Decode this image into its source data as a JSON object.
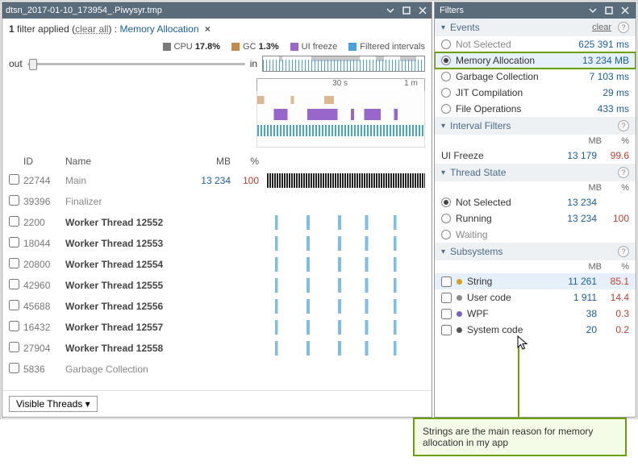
{
  "left": {
    "title": "dtsn_2017-01-10_173954_.Piwysyr.tmp",
    "filterbar": {
      "count": "1",
      "applied_text": "filter applied",
      "clear_all": "clear all",
      "active_filter": "Memory Allocation"
    },
    "legend": {
      "cpu_label": "CPU",
      "cpu_value": "17.8%",
      "gc_label": "GC",
      "gc_value": "1.3%",
      "ui_label": "UI freeze",
      "fi_label": "Filtered intervals",
      "out": "out",
      "in": "in"
    },
    "timeline": {
      "t1": "30 s",
      "t2": "1 m"
    },
    "columns": {
      "id": "ID",
      "name": "Name",
      "mb": "MB",
      "pct": "%"
    },
    "threads": [
      {
        "id": "22744",
        "name": "Main",
        "bold": false,
        "mb": "13 234",
        "pct": "100",
        "spark": "full"
      },
      {
        "id": "39396",
        "name": "Finalizer",
        "bold": false,
        "mb": "",
        "pct": "",
        "spark": "none"
      },
      {
        "id": "2200",
        "name": "Worker Thread 12552",
        "bold": true,
        "mb": "",
        "pct": "",
        "spark": "blue"
      },
      {
        "id": "18044",
        "name": "Worker Thread 12553",
        "bold": true,
        "mb": "",
        "pct": "",
        "spark": "blue"
      },
      {
        "id": "20800",
        "name": "Worker Thread 12554",
        "bold": true,
        "mb": "",
        "pct": "",
        "spark": "blue"
      },
      {
        "id": "42960",
        "name": "Worker Thread 12555",
        "bold": true,
        "mb": "",
        "pct": "",
        "spark": "blue"
      },
      {
        "id": "45688",
        "name": "Worker Thread 12556",
        "bold": true,
        "mb": "",
        "pct": "",
        "spark": "blue"
      },
      {
        "id": "16432",
        "name": "Worker Thread 12557",
        "bold": true,
        "mb": "",
        "pct": "",
        "spark": "blue"
      },
      {
        "id": "27904",
        "name": "Worker Thread 12558",
        "bold": true,
        "mb": "",
        "pct": "",
        "spark": "blue"
      },
      {
        "id": "5836",
        "name": "Garbage Collection",
        "bold": false,
        "mb": "",
        "pct": "",
        "spark": "none"
      }
    ],
    "visible_threads_btn": "Visible Threads"
  },
  "right": {
    "title": "Filters",
    "sections": {
      "events": {
        "label": "Events",
        "clear": "clear"
      },
      "interval": {
        "label": "Interval Filters"
      },
      "threadstate": {
        "label": "Thread State"
      },
      "subsystems": {
        "label": "Subsystems"
      }
    },
    "events": [
      {
        "label": "Not Selected",
        "val": "625 391 ms",
        "selected": false,
        "dim": true
      },
      {
        "label": "Memory Allocation",
        "val": "13 234 MB",
        "selected": true,
        "boxed": true
      },
      {
        "label": "Garbage Collection",
        "val": "7 103 ms",
        "selected": false
      },
      {
        "label": "JIT Compilation",
        "val": "29 ms",
        "selected": false
      },
      {
        "label": "File Operations",
        "val": "433 ms",
        "selected": false
      }
    ],
    "hdr": {
      "mb": "MB",
      "pct": "%"
    },
    "interval": [
      {
        "label": "UI Freeze",
        "mb": "13 179",
        "pct": "99.6"
      }
    ],
    "threadstate": [
      {
        "label": "Not Selected",
        "mb": "13 234",
        "pct": "",
        "selected": true
      },
      {
        "label": "Running",
        "mb": "13 234",
        "pct": "100",
        "selected": false
      },
      {
        "label": "Waiting",
        "mb": "",
        "pct": "",
        "selected": false,
        "dim": true
      }
    ],
    "subsystems": [
      {
        "label": "String",
        "dot": "d-y",
        "mb": "11 261",
        "pct": "85.1",
        "sel": true
      },
      {
        "label": "User code",
        "dot": "d-g",
        "mb": "1 911",
        "pct": "14.4"
      },
      {
        "label": "WPF",
        "dot": "d-p",
        "mb": "38",
        "pct": "0.3"
      },
      {
        "label": "System code",
        "dot": "d-k",
        "mb": "20",
        "pct": "0.2"
      }
    ]
  },
  "callout": "Strings are the main reason for memory allocation in my app"
}
